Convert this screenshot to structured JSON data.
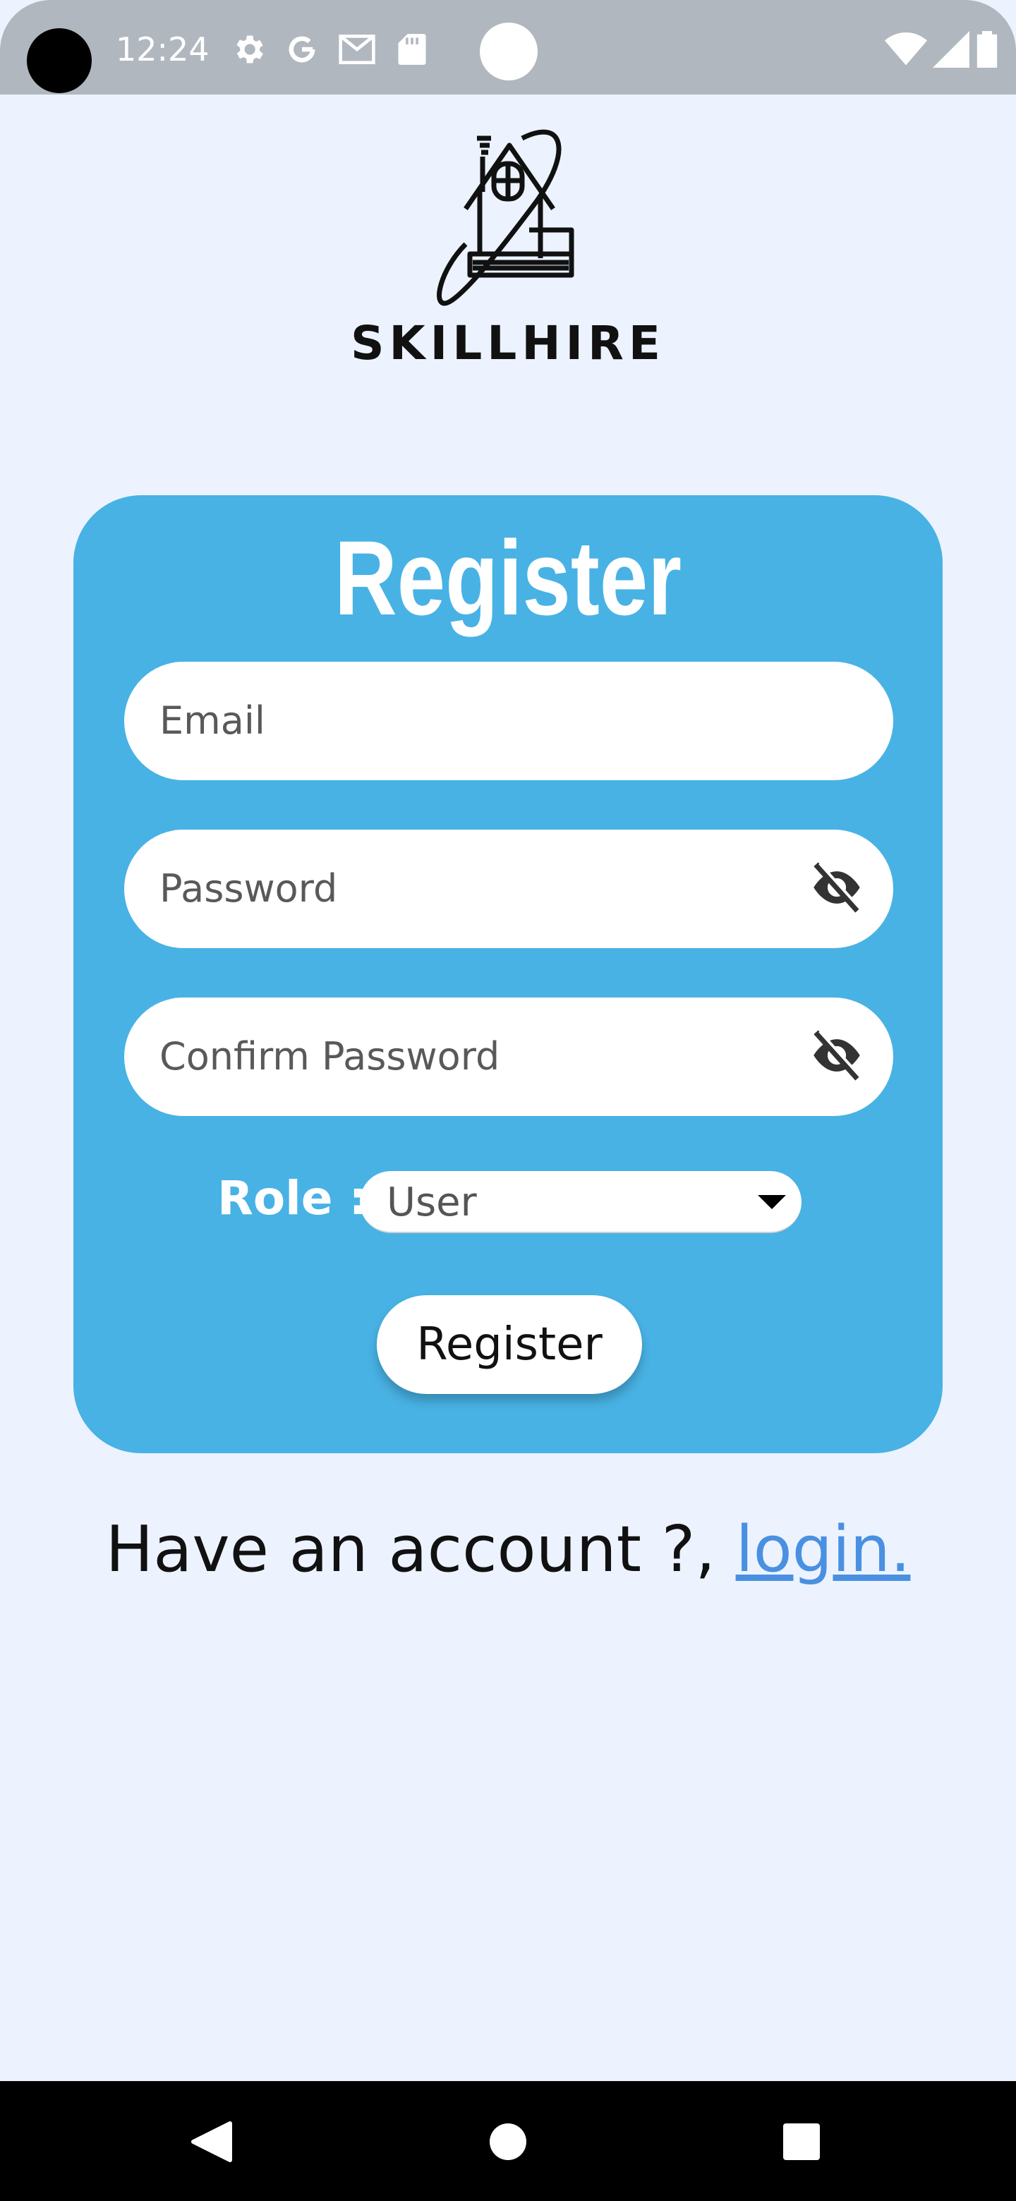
{
  "status_bar": {
    "time": "12:24",
    "icons": [
      "settings-icon",
      "google-icon",
      "gmail-icon",
      "sd-card-icon",
      "wifi-icon",
      "signal-icon",
      "battery-icon"
    ]
  },
  "logo": {
    "name": "SKILLHIRE"
  },
  "form": {
    "title": "Register",
    "email_placeholder": "Email",
    "password_placeholder": "Password",
    "confirm_password_placeholder": "Confirm Password",
    "role_label": "Role :",
    "role_value": "User",
    "submit_label": "Register"
  },
  "footer": {
    "prompt": "Have an account ?, ",
    "login_link": "login."
  },
  "colors": {
    "background": "#ecf3fe",
    "card": "#48b2e4",
    "link": "#4a90e2",
    "status_bar": "#b0b7bf"
  }
}
